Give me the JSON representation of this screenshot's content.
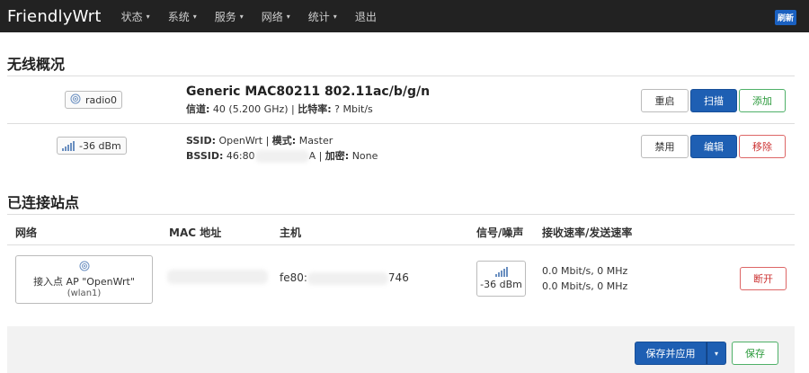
{
  "nav": {
    "brand": "FriendlyWrt",
    "menu": [
      {
        "label": "状态",
        "caret": "▾"
      },
      {
        "label": "系统",
        "caret": "▾"
      },
      {
        "label": "服务",
        "caret": "▾"
      },
      {
        "label": "网络",
        "caret": "▾"
      },
      {
        "label": "统计",
        "caret": "▾"
      },
      {
        "label": "退出",
        "caret": ""
      }
    ],
    "refresh_label": "刷新"
  },
  "wireless": {
    "title": "无线概况",
    "radio": {
      "chip_label": "radio0",
      "icon": "wifi-icon",
      "name": "Generic MAC80211 802.11ac/b/g/n",
      "channel_label": "信道:",
      "channel_value": "40 (5.200 GHz)",
      "bitrate_label": "比特率:",
      "bitrate_value": "? Mbit/s",
      "buttons": {
        "restart": "重启",
        "scan": "扫描",
        "add": "添加"
      }
    },
    "network": {
      "signal_chip": "-36 dBm",
      "ssid_label": "SSID:",
      "ssid_value": "OpenWrt",
      "mode_label": "模式:",
      "mode_value": "Master",
      "bssid_label": "BSSID:",
      "bssid_prefix": "46:80",
      "bssid_suffix": "A",
      "enc_label": "加密:",
      "enc_value": "None",
      "buttons": {
        "disable": "禁用",
        "edit": "编辑",
        "remove": "移除"
      }
    }
  },
  "stations": {
    "title": "已连接站点",
    "headers": {
      "network": "网络",
      "mac": "MAC 地址",
      "host": "主机",
      "signal": "信号/噪声",
      "rate": "接收速率/发送速率"
    },
    "row": {
      "ap_line1": "接入点 AP \"OpenWrt\"",
      "ap_line2": "(wlan1)",
      "host_prefix": "fe80:",
      "host_suffix": "746",
      "signal": "-36 dBm",
      "rx": "0.0 Mbit/s, 0 MHz",
      "tx": "0.0 Mbit/s, 0 MHz",
      "disconnect": "断开"
    }
  },
  "footer": {
    "save_apply": "保存并应用",
    "dropdown_caret": "▾",
    "save": "保存"
  }
}
